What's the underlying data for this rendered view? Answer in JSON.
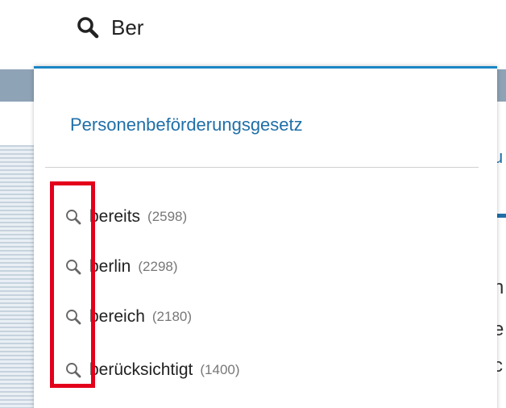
{
  "search": {
    "query": "Ber",
    "icon": "search-icon"
  },
  "dropdown": {
    "title": "Personenbeförderungsgesetz",
    "accent_color": "#1b85c4",
    "suggestions": [
      {
        "word": "bereits",
        "count": "(2598)",
        "icon": "search-icon"
      },
      {
        "word": "berlin",
        "count": "(2298)",
        "icon": "search-icon"
      },
      {
        "word": "bereich",
        "count": "(2180)",
        "icon": "search-icon"
      },
      {
        "word": "berücksichtigt",
        "count": "(1400)",
        "icon": "search-icon"
      }
    ]
  },
  "annotation": {
    "highlight_color": "#e3001b"
  },
  "background": {
    "partial_chars": [
      "u",
      "n",
      "e",
      "c"
    ]
  }
}
